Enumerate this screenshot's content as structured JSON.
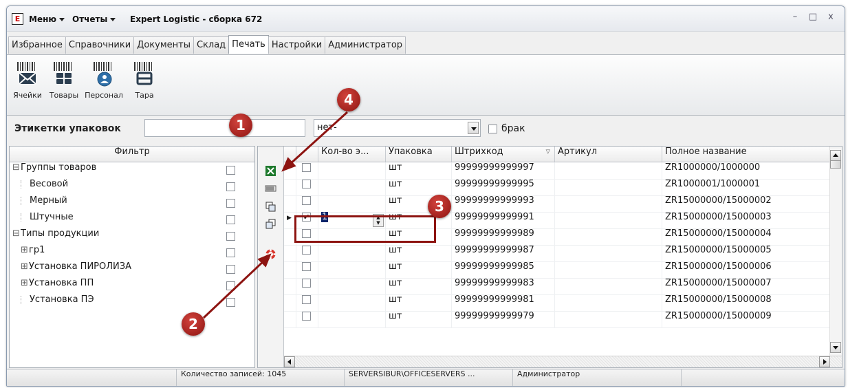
{
  "window": {
    "logo": "E",
    "menu_label": "Меню",
    "reports_label": "Отчеты",
    "title": "Expert Logistic - сборка 672",
    "minimize": "–",
    "maximize": "□",
    "close": "x"
  },
  "tabs": [
    "Избранное",
    "Справочники",
    "Документы",
    "Склад",
    "Печать",
    "Настройки",
    "Администратор"
  ],
  "active_tab": "Печать",
  "ribbon": {
    "buttons": [
      {
        "label": "Ячейки",
        "icon": "barcode-envelope-icon"
      },
      {
        "label": "Товары",
        "icon": "barcode-goods-icon"
      },
      {
        "label": "Персонал",
        "icon": "barcode-person-icon"
      },
      {
        "label": "Тара",
        "icon": "barcode-container-icon"
      }
    ]
  },
  "filterbar": {
    "label": "Этикетки упаковок",
    "search_value": "",
    "select_value": "нет-",
    "checkbox_label": "брак",
    "checkbox_checked": false
  },
  "filter_panel": {
    "header": "Фильтр",
    "tree": [
      {
        "label": "Группы товаров",
        "level": 0,
        "expander": "⊟"
      },
      {
        "label": "Весовой",
        "level": 1,
        "expander": ""
      },
      {
        "label": "Мерный",
        "level": 1,
        "expander": ""
      },
      {
        "label": "Штучные",
        "level": 1,
        "expander": ""
      },
      {
        "label": "Типы продукции",
        "level": 0,
        "expander": "⊟"
      },
      {
        "label": "гр1",
        "level": 1,
        "expander": "⊞"
      },
      {
        "label": "Установка ПИРОЛИЗА",
        "level": 1,
        "expander": "⊞"
      },
      {
        "label": "Установка ПП",
        "level": 1,
        "expander": "⊞"
      },
      {
        "label": "Установка ПЭ",
        "level": 1,
        "expander": ""
      }
    ]
  },
  "grid": {
    "columns": [
      "",
      "Кол-во э...",
      "Упаковка",
      "Штрихкод",
      "Артикул",
      "Полное название"
    ],
    "rows": [
      {
        "checked": false,
        "qty": "",
        "pack": "шт",
        "barcode": "99999999999997",
        "article": "",
        "name": "ZR1000000/1000000"
      },
      {
        "checked": false,
        "qty": "",
        "pack": "шт",
        "barcode": "99999999999995",
        "article": "",
        "name": "ZR1000001/1000001"
      },
      {
        "checked": false,
        "qty": "",
        "pack": "шт",
        "barcode": "99999999999993",
        "article": "",
        "name": "ZR15000000/15000002"
      },
      {
        "checked": true,
        "qty": "1",
        "pack": "шт",
        "barcode": "99999999999991",
        "article": "",
        "name": "ZR15000000/15000003"
      },
      {
        "checked": false,
        "qty": "",
        "pack": "шт",
        "barcode": "99999999999989",
        "article": "",
        "name": "ZR15000000/15000004"
      },
      {
        "checked": false,
        "qty": "",
        "pack": "шт",
        "barcode": "99999999999987",
        "article": "",
        "name": "ZR15000000/15000005"
      },
      {
        "checked": false,
        "qty": "",
        "pack": "шт",
        "barcode": "99999999999985",
        "article": "",
        "name": "ZR15000000/15000006"
      },
      {
        "checked": false,
        "qty": "",
        "pack": "шт",
        "barcode": "99999999999983",
        "article": "",
        "name": "ZR15000000/15000007"
      },
      {
        "checked": false,
        "qty": "",
        "pack": "шт",
        "barcode": "99999999999981",
        "article": "",
        "name": "ZR15000000/15000008"
      },
      {
        "checked": false,
        "qty": "",
        "pack": "шт",
        "barcode": "99999999999979",
        "article": "",
        "name": "ZR15000000/15000009"
      }
    ],
    "current_row": 3,
    "side_tools": [
      "excel-icon",
      "barcode-print-icon",
      "copy-icon",
      "copy-down-icon",
      "lifebuoy-icon"
    ]
  },
  "statusbar": {
    "records": "Количество записей: 1045",
    "server": "SERVERSIBUR\\OFFICESERVERS ...",
    "user": "Администратор"
  },
  "annotations": [
    "1",
    "2",
    "3",
    "4"
  ],
  "colors": {
    "annotation": "#8d1411",
    "excel_green": "#1f7a2e"
  }
}
